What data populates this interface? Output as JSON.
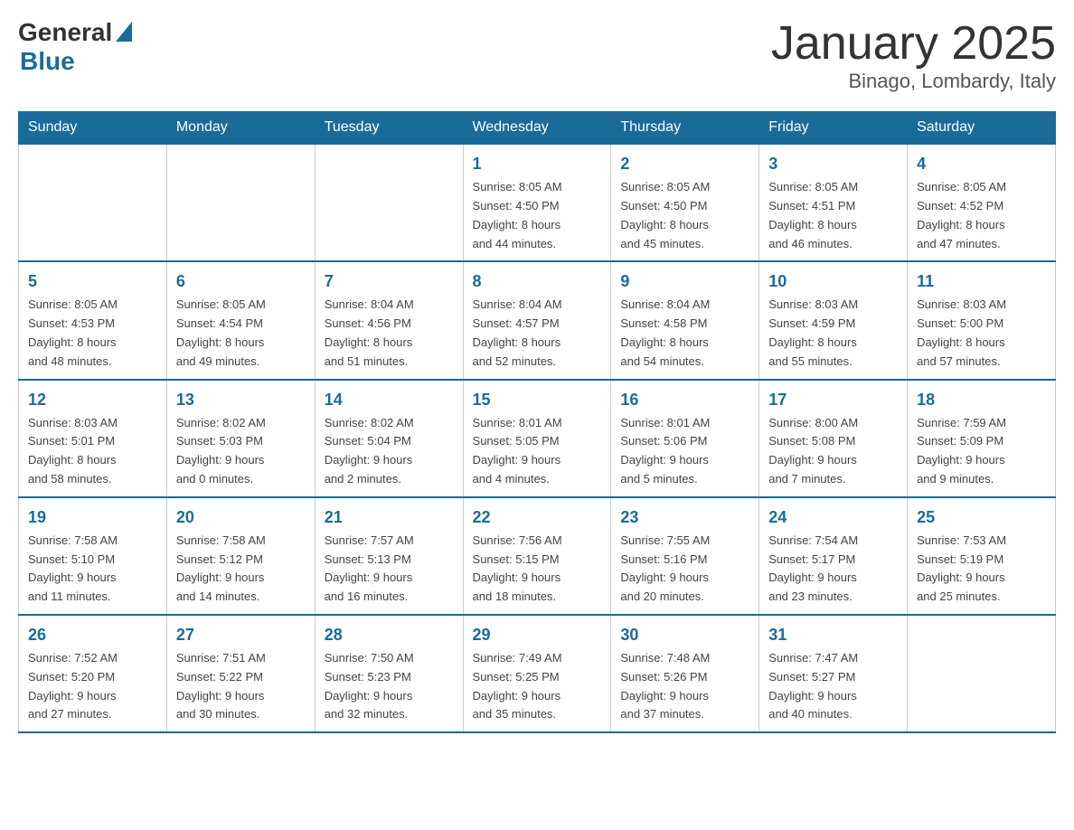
{
  "header": {
    "logo": {
      "general": "General",
      "blue": "Blue"
    },
    "title": "January 2025",
    "subtitle": "Binago, Lombardy, Italy"
  },
  "weekdays": [
    "Sunday",
    "Monday",
    "Tuesday",
    "Wednesday",
    "Thursday",
    "Friday",
    "Saturday"
  ],
  "weeks": [
    [
      {
        "day": "",
        "info": ""
      },
      {
        "day": "",
        "info": ""
      },
      {
        "day": "",
        "info": ""
      },
      {
        "day": "1",
        "info": "Sunrise: 8:05 AM\nSunset: 4:50 PM\nDaylight: 8 hours\nand 44 minutes."
      },
      {
        "day": "2",
        "info": "Sunrise: 8:05 AM\nSunset: 4:50 PM\nDaylight: 8 hours\nand 45 minutes."
      },
      {
        "day": "3",
        "info": "Sunrise: 8:05 AM\nSunset: 4:51 PM\nDaylight: 8 hours\nand 46 minutes."
      },
      {
        "day": "4",
        "info": "Sunrise: 8:05 AM\nSunset: 4:52 PM\nDaylight: 8 hours\nand 47 minutes."
      }
    ],
    [
      {
        "day": "5",
        "info": "Sunrise: 8:05 AM\nSunset: 4:53 PM\nDaylight: 8 hours\nand 48 minutes."
      },
      {
        "day": "6",
        "info": "Sunrise: 8:05 AM\nSunset: 4:54 PM\nDaylight: 8 hours\nand 49 minutes."
      },
      {
        "day": "7",
        "info": "Sunrise: 8:04 AM\nSunset: 4:56 PM\nDaylight: 8 hours\nand 51 minutes."
      },
      {
        "day": "8",
        "info": "Sunrise: 8:04 AM\nSunset: 4:57 PM\nDaylight: 8 hours\nand 52 minutes."
      },
      {
        "day": "9",
        "info": "Sunrise: 8:04 AM\nSunset: 4:58 PM\nDaylight: 8 hours\nand 54 minutes."
      },
      {
        "day": "10",
        "info": "Sunrise: 8:03 AM\nSunset: 4:59 PM\nDaylight: 8 hours\nand 55 minutes."
      },
      {
        "day": "11",
        "info": "Sunrise: 8:03 AM\nSunset: 5:00 PM\nDaylight: 8 hours\nand 57 minutes."
      }
    ],
    [
      {
        "day": "12",
        "info": "Sunrise: 8:03 AM\nSunset: 5:01 PM\nDaylight: 8 hours\nand 58 minutes."
      },
      {
        "day": "13",
        "info": "Sunrise: 8:02 AM\nSunset: 5:03 PM\nDaylight: 9 hours\nand 0 minutes."
      },
      {
        "day": "14",
        "info": "Sunrise: 8:02 AM\nSunset: 5:04 PM\nDaylight: 9 hours\nand 2 minutes."
      },
      {
        "day": "15",
        "info": "Sunrise: 8:01 AM\nSunset: 5:05 PM\nDaylight: 9 hours\nand 4 minutes."
      },
      {
        "day": "16",
        "info": "Sunrise: 8:01 AM\nSunset: 5:06 PM\nDaylight: 9 hours\nand 5 minutes."
      },
      {
        "day": "17",
        "info": "Sunrise: 8:00 AM\nSunset: 5:08 PM\nDaylight: 9 hours\nand 7 minutes."
      },
      {
        "day": "18",
        "info": "Sunrise: 7:59 AM\nSunset: 5:09 PM\nDaylight: 9 hours\nand 9 minutes."
      }
    ],
    [
      {
        "day": "19",
        "info": "Sunrise: 7:58 AM\nSunset: 5:10 PM\nDaylight: 9 hours\nand 11 minutes."
      },
      {
        "day": "20",
        "info": "Sunrise: 7:58 AM\nSunset: 5:12 PM\nDaylight: 9 hours\nand 14 minutes."
      },
      {
        "day": "21",
        "info": "Sunrise: 7:57 AM\nSunset: 5:13 PM\nDaylight: 9 hours\nand 16 minutes."
      },
      {
        "day": "22",
        "info": "Sunrise: 7:56 AM\nSunset: 5:15 PM\nDaylight: 9 hours\nand 18 minutes."
      },
      {
        "day": "23",
        "info": "Sunrise: 7:55 AM\nSunset: 5:16 PM\nDaylight: 9 hours\nand 20 minutes."
      },
      {
        "day": "24",
        "info": "Sunrise: 7:54 AM\nSunset: 5:17 PM\nDaylight: 9 hours\nand 23 minutes."
      },
      {
        "day": "25",
        "info": "Sunrise: 7:53 AM\nSunset: 5:19 PM\nDaylight: 9 hours\nand 25 minutes."
      }
    ],
    [
      {
        "day": "26",
        "info": "Sunrise: 7:52 AM\nSunset: 5:20 PM\nDaylight: 9 hours\nand 27 minutes."
      },
      {
        "day": "27",
        "info": "Sunrise: 7:51 AM\nSunset: 5:22 PM\nDaylight: 9 hours\nand 30 minutes."
      },
      {
        "day": "28",
        "info": "Sunrise: 7:50 AM\nSunset: 5:23 PM\nDaylight: 9 hours\nand 32 minutes."
      },
      {
        "day": "29",
        "info": "Sunrise: 7:49 AM\nSunset: 5:25 PM\nDaylight: 9 hours\nand 35 minutes."
      },
      {
        "day": "30",
        "info": "Sunrise: 7:48 AM\nSunset: 5:26 PM\nDaylight: 9 hours\nand 37 minutes."
      },
      {
        "day": "31",
        "info": "Sunrise: 7:47 AM\nSunset: 5:27 PM\nDaylight: 9 hours\nand 40 minutes."
      },
      {
        "day": "",
        "info": ""
      }
    ]
  ]
}
